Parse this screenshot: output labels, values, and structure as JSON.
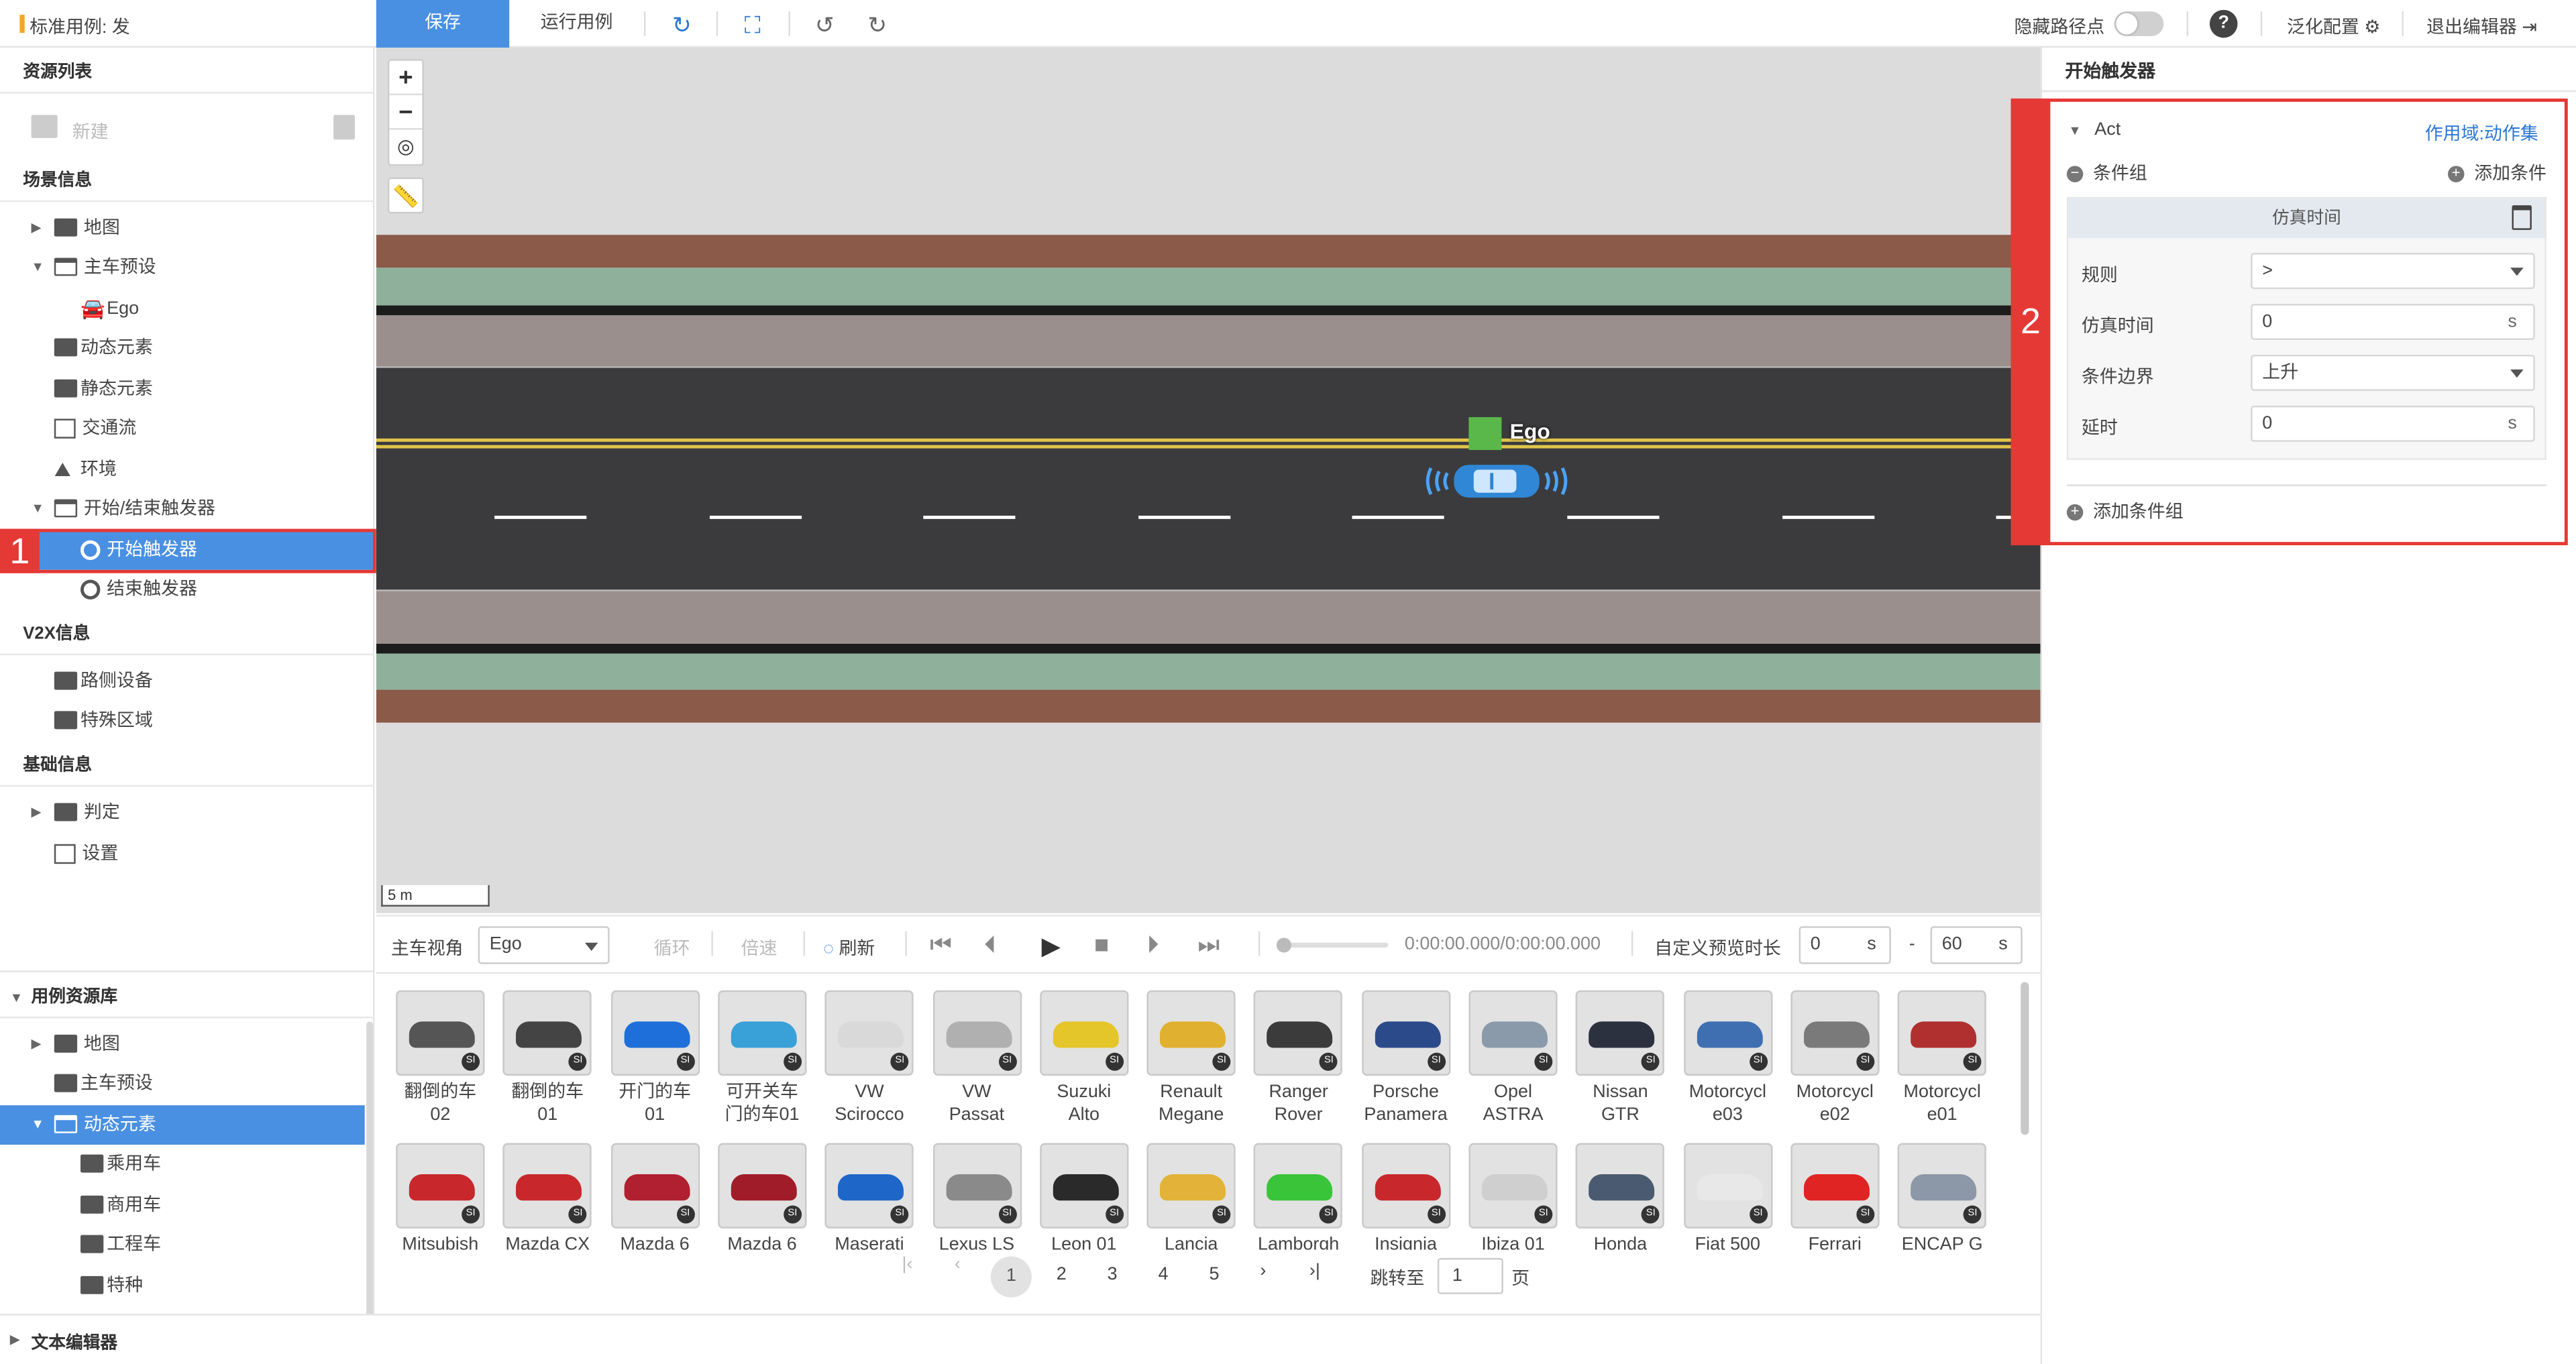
{
  "topbar": {
    "case_name": "标准用例: 发",
    "save_label": "保存",
    "run_label": "运行用例",
    "hide_waypoints_label": "隐藏路径点",
    "help_label": "?",
    "generalize_label": "泛化配置",
    "exit_label": "退出编辑器"
  },
  "left": {
    "resource_list_title": "资源列表",
    "new_label": "新建",
    "scene_info_title": "场景信息",
    "scene_items": [
      "地图",
      "主车预设",
      "Ego",
      "动态元素",
      "静态元素",
      "交通流",
      "环境",
      "开始/结束触发器",
      "开始触发器",
      "结束触发器"
    ],
    "v2x_title": "V2X信息",
    "v2x_items": [
      "路侧设备",
      "特殊区域"
    ],
    "base_title": "基础信息",
    "base_items": [
      "判定",
      "设置"
    ],
    "case_lib_title": "用例资源库",
    "case_lib_items": [
      "地图",
      "主车预设",
      "动态元素",
      "乘用车",
      "商用车",
      "工程车",
      "特种"
    ],
    "text_editor": "文本编辑器"
  },
  "annotations": {
    "box1": "1",
    "box2": "2"
  },
  "map": {
    "ego_label": "Ego",
    "scale_label": "5 m"
  },
  "playback": {
    "view_label": "主车视角",
    "view_value": "Ego",
    "loop_label": "循环",
    "speed_label": "倍速",
    "refresh_label": "刷新",
    "time_text": "0:00:00.000/0:00:00.000",
    "custom_preview_label": "自定义预览时长",
    "preview_start": "0",
    "preview_end": "60",
    "unit_s": "s",
    "dash": "-"
  },
  "library": {
    "row1": [
      "翻倒的车\n02",
      "翻倒的车\n01",
      "开门的车\n01",
      "可开关车\n门的车01",
      "VW\nScirocco",
      "VW\nPassat",
      "Suzuki\nAlto",
      "Renault\nMegane",
      "Ranger\nRover",
      "Porsche\nPanamera",
      "Opel\nASTRA",
      "Nissan\nGTR",
      "Motorcycl\ne03",
      "Motorcycl\ne02",
      "Motorcycl\ne01"
    ],
    "row2": [
      "Mitsubish",
      "Mazda CX",
      "Mazda 6",
      "Mazda 6",
      "Maserati",
      "Lexus LS",
      "Leon 01",
      "Lancia",
      "Lamborgh",
      "Insignia",
      "Ibiza 01",
      "Honda",
      "Fiat 500",
      "Ferrari",
      "ENCAP G"
    ],
    "badge": "SI",
    "pages": [
      "1",
      "2",
      "3",
      "4",
      "5"
    ],
    "jump_label": "跳转至",
    "jump_value": "1",
    "page_suffix": "页"
  },
  "right": {
    "title": "开始触发器",
    "act_label": "Act",
    "scope_label": "作用域:",
    "scope_value": "动作集",
    "cond_group_label": "条件组",
    "add_cond_label": "添加条件",
    "card_title": "仿真时间",
    "rule_label": "规则",
    "rule_value": ">",
    "sim_time_label": "仿真时间",
    "sim_time_value": "0",
    "edge_label": "条件边界",
    "edge_value": "上升",
    "delay_label": "延时",
    "delay_value": "0",
    "unit": "s",
    "add_group_label": "添加条件组"
  },
  "colors": {
    "accent": "#4a90e2",
    "highlight": "#e53935",
    "road": "#3b3b3d",
    "dirt": "#8b5a48",
    "grass": "#8fb09a",
    "sidewalk": "#9a8f8c",
    "ego_marker": "#5ab84a"
  }
}
